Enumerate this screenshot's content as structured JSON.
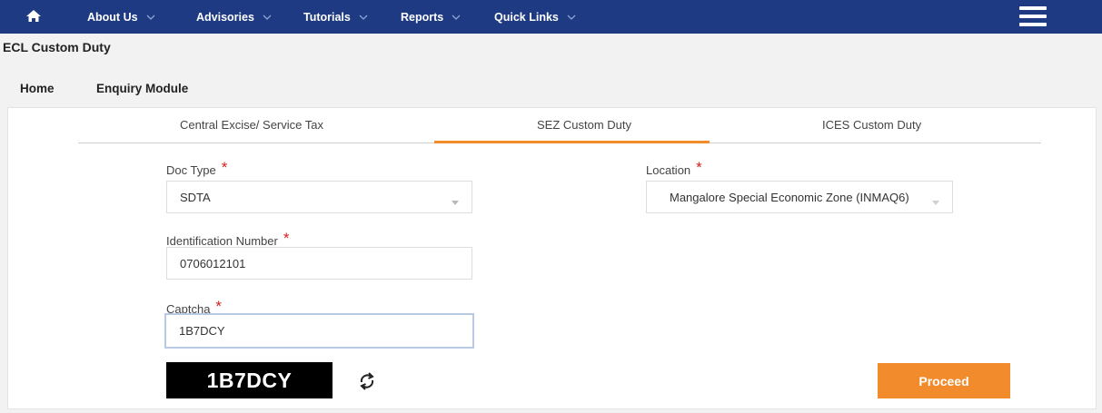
{
  "nav": {
    "home_icon": "home-icon",
    "items": [
      {
        "label": "About Us"
      },
      {
        "label": "Advisories"
      },
      {
        "label": "Tutorials"
      },
      {
        "label": "Reports"
      },
      {
        "label": "Quick Links"
      }
    ],
    "menu_icon": "hamburger-icon"
  },
  "page": {
    "title": "ECL Custom Duty"
  },
  "breadcrumb": {
    "home": "Home",
    "current": "Enquiry Module"
  },
  "tabs": [
    {
      "label": "Central Excise/ Service Tax",
      "active": false
    },
    {
      "label": "SEZ Custom Duty",
      "active": true
    },
    {
      "label": "ICES Custom Duty",
      "active": false
    }
  ],
  "form": {
    "doc_type": {
      "label": "Doc Type",
      "value": "SDTA"
    },
    "location": {
      "label": "Location",
      "value": "Mangalore Special Economic Zone (INMAQ6)"
    },
    "identification_number": {
      "label": "Identification Number",
      "value": "0706012101"
    },
    "captcha": {
      "label": "Captcha",
      "value": "1B7DCY",
      "image_text": "1B7DCY"
    },
    "required_mark": "*",
    "proceed_label": "Proceed"
  },
  "colors": {
    "nav_bg": "#1d3a83",
    "accent": "#f28b2b",
    "required": "#d42020"
  }
}
